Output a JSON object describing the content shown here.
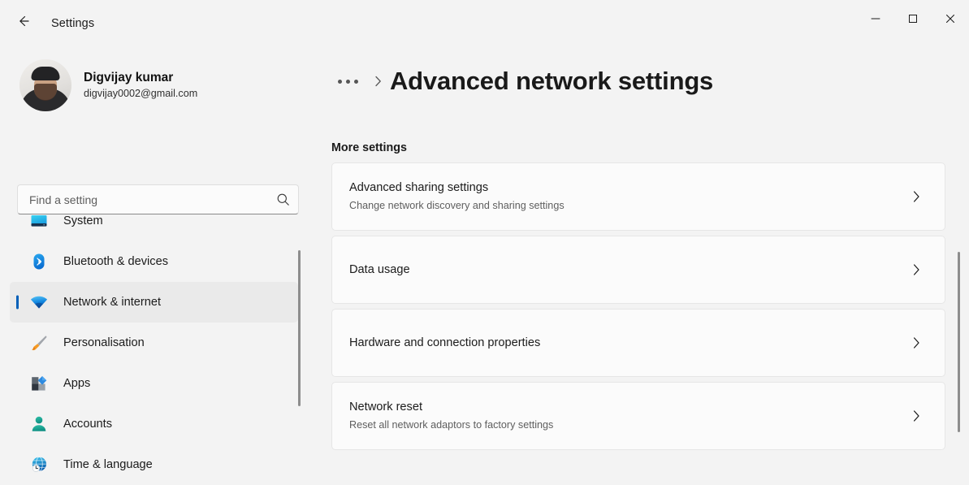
{
  "window": {
    "title": "Settings",
    "back_label": "Back",
    "controls": {
      "minimize": "Minimise",
      "maximize": "Maximise",
      "close": "Close"
    }
  },
  "profile": {
    "name": "Digvijay kumar",
    "email": "digvijay0002@gmail.com"
  },
  "search": {
    "placeholder": "Find a setting",
    "value": "",
    "icon": "search-icon"
  },
  "sidebar": {
    "items": [
      {
        "label": "System",
        "icon": "monitor-icon",
        "selected": false
      },
      {
        "label": "Bluetooth & devices",
        "icon": "bluetooth-icon",
        "selected": false
      },
      {
        "label": "Network & internet",
        "icon": "wifi-icon",
        "selected": true
      },
      {
        "label": "Personalisation",
        "icon": "paintbrush-icon",
        "selected": false
      },
      {
        "label": "Apps",
        "icon": "apps-grid-icon",
        "selected": false
      },
      {
        "label": "Accounts",
        "icon": "person-icon",
        "selected": false
      },
      {
        "label": "Time & language",
        "icon": "globe-clock-icon",
        "selected": false
      }
    ]
  },
  "main": {
    "breadcrumb": {
      "overflow": "...",
      "separator": "chevron-right-icon"
    },
    "page_title": "Advanced network settings",
    "section_label": "More settings",
    "cards": [
      {
        "title": "Advanced sharing settings",
        "subtitle": "Change network discovery and sharing settings",
        "chevron": "chevron-right-icon"
      },
      {
        "title": "Data usage",
        "subtitle": "",
        "chevron": "chevron-right-icon"
      },
      {
        "title": "Hardware and connection properties",
        "subtitle": "",
        "chevron": "chevron-right-icon"
      },
      {
        "title": "Network reset",
        "subtitle": "Reset all network adaptors to factory settings",
        "chevron": "chevron-right-icon"
      }
    ]
  },
  "colors": {
    "accent": "#005fb8",
    "window_bg": "#f3f3f3",
    "card_bg": "#fbfbfb",
    "selected_row": "#eaeaea",
    "text_primary": "#1b1b1b",
    "text_secondary": "#5e5e5e",
    "scrollbar": "#8d8d8d"
  }
}
